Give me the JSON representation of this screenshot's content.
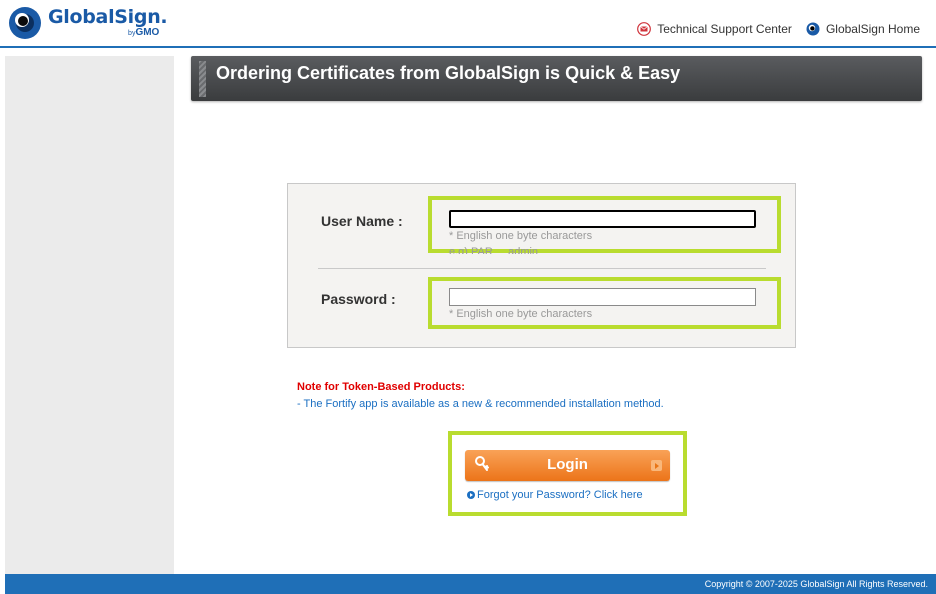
{
  "header": {
    "logo_text": "GlobalSign",
    "logo_dot": ".",
    "logo_by": "by",
    "logo_sub": "GMO",
    "links": [
      {
        "label": "Technical Support Center",
        "icon": "mail-icon"
      },
      {
        "label": "GlobalSign Home",
        "icon": "globalsign-eye-icon"
      }
    ]
  },
  "title": "Ordering Certificates from GlobalSign is Quick & Easy",
  "form": {
    "username_label": "User Name :",
    "username_value": "",
    "username_hint": "* English one byte characters",
    "username_example": "e.g) PAR     admin",
    "password_label": "Password :",
    "password_value": "",
    "password_hint": "* English one byte characters"
  },
  "note": {
    "title": "Note for Token-Based Products:",
    "text": "- The Fortify app is available as a new & recommended installation method."
  },
  "login": {
    "button_label": "Login",
    "forgot_label": "Forgot your Password? Click here"
  },
  "footer": {
    "copyright": "Copyright © 2007-2025 GlobalSign All Rights Reserved."
  },
  "colors": {
    "brand_blue": "#1f6fb7",
    "highlight_green": "#b9dc2f",
    "login_orange": "#ec7419",
    "note_red": "#e00000"
  }
}
